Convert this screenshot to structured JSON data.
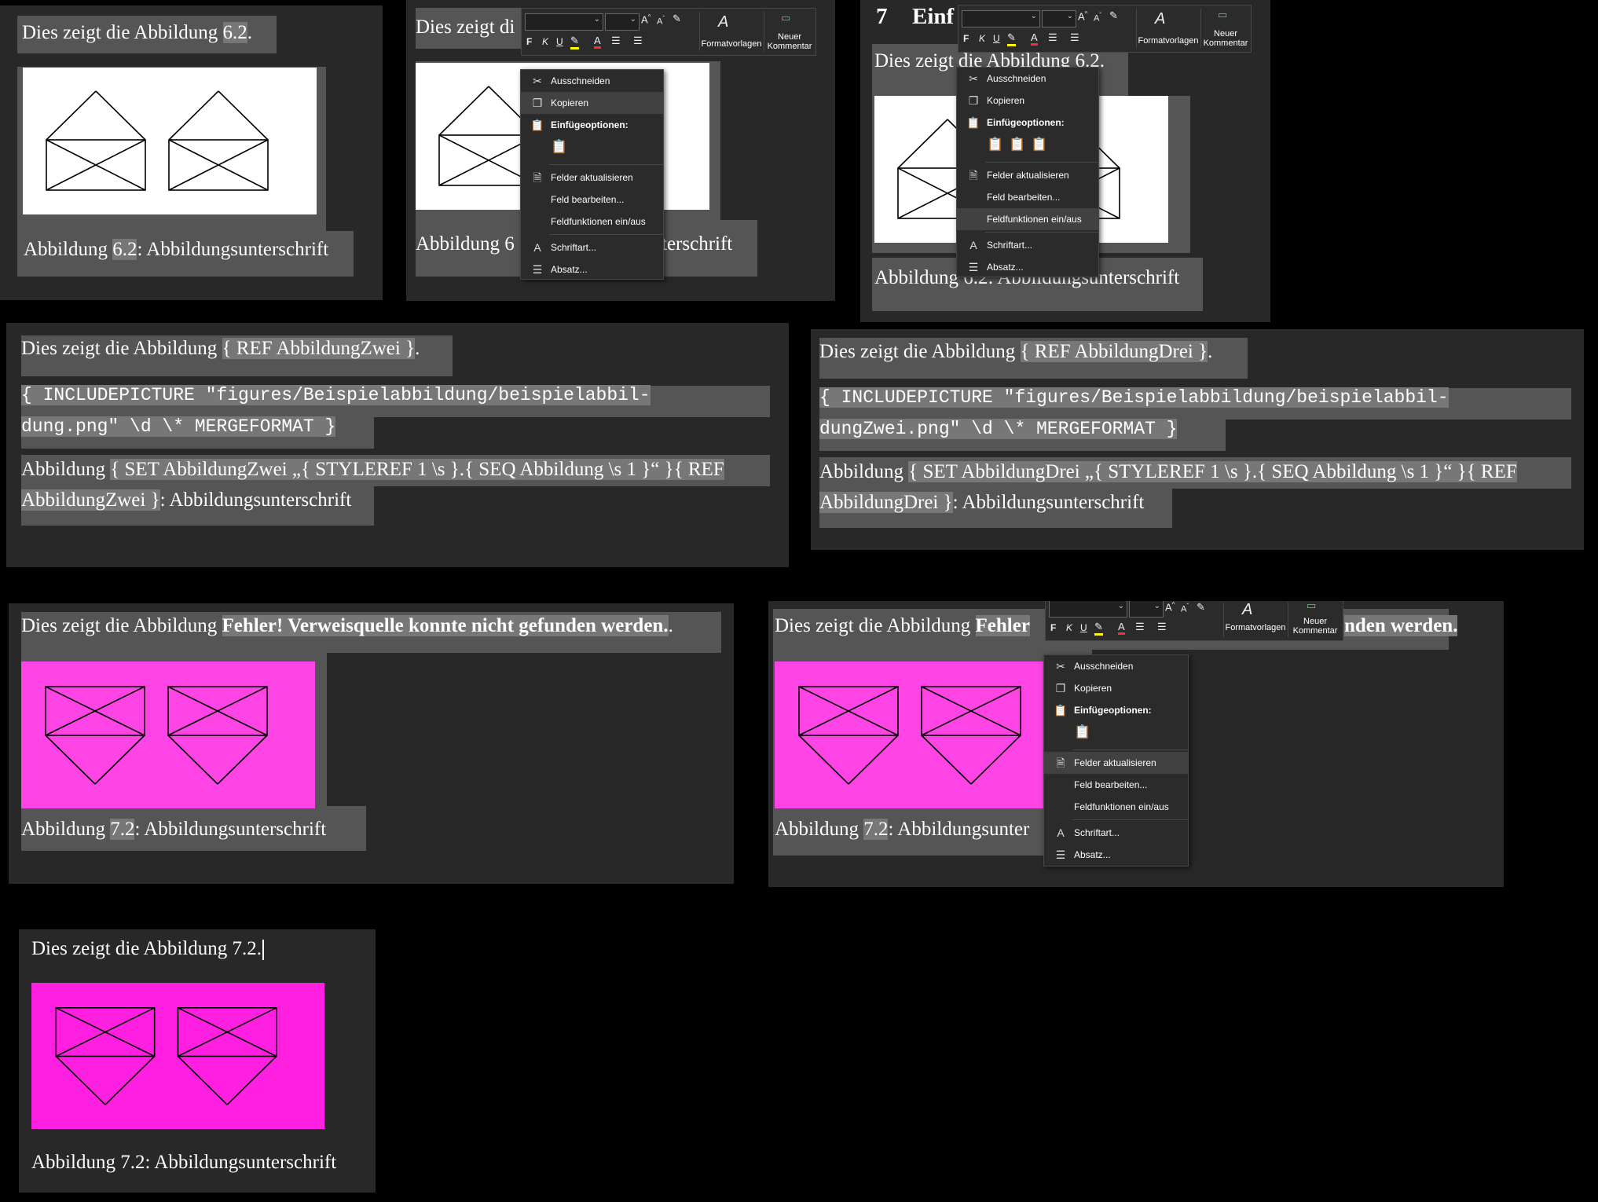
{
  "common": {
    "intro_prefix": "Dies zeigt die Abbildung ",
    "caption_word": "Abbildung",
    "caption_suffix": ": Abbildungsunterschrift",
    "period": ".",
    "caption_spaced": "Abbildung "
  },
  "panel_a": {
    "ref": "6.2"
  },
  "panel_b": {
    "intro_visible": "Dies zeigt di",
    "caption_start": "Abbildung 6",
    "caption_end": "terschrift"
  },
  "panel_c": {
    "heading_num": "7",
    "heading_text": "Einf",
    "intro_visible": "Dies zeigt die Abbildung 6.2.",
    "caption_visible": "Abbildung 6.2: Abbildungsunterschrift"
  },
  "panel_d": {
    "ref_field": "{ REF AbbildungZwei }",
    "include_line1": "{  INCLUDEPICTURE   \"figures/Beispielabbildung/beispielabbil-",
    "include_line2": "dung.png\" \\d \\* MERGEFORMAT }",
    "caption_field_line1": "{ SET AbbildungZwei „{ STYLEREF 1 \\s }.{ SEQ Abbildung \\s 1 }“ }{ REF",
    "caption_field_line2": "AbbildungZwei }"
  },
  "panel_e": {
    "ref_field": "{ REF AbbildungDrei }",
    "include_line1": "{  INCLUDEPICTURE   \"figures/Beispielabbildung/beispielabbil-",
    "include_line2": "dungZwei.png\" \\d \\* MERGEFORMAT }",
    "caption_field_line1": "{ SET AbbildungDrei „{ STYLEREF 1 \\s }.{ SEQ Abbildung \\s 1 }“ }{ REF",
    "caption_field_line2": "AbbildungDrei }"
  },
  "panel_f": {
    "error": "Fehler! Verweisquelle konnte nicht gefunden werden.",
    "ref": "7.2"
  },
  "panel_g": {
    "error_start": "Fehler",
    "error_end": "nden werden.",
    "ref": "7.2",
    "caption_end": ": Abbildungsunter"
  },
  "panel_h": {
    "intro": "Dies zeigt die Abbildung 7.2.",
    "caption_prefix": "Abbildung ",
    "caption_rest": "7.2: Abbildungsunterschrift"
  },
  "context_menu": {
    "cut": "Ausschneiden",
    "copy": "Kopieren",
    "paste_options": "Einfügeoptionen:",
    "update_fields": "Felder aktualisieren",
    "edit_field": "Feld bearbeiten...",
    "toggle_field_codes": "Feldfunktionen ein/aus",
    "font": "Schriftart...",
    "paragraph": "Absatz..."
  },
  "mini_toolbar": {
    "bold": "F",
    "italic": "K",
    "underline": "U",
    "styles": "Formatvorlagen",
    "new_comment_line1": "Neuer",
    "new_comment_line2": "Kommentar"
  },
  "icons": {
    "cut": "scissors-icon",
    "copy": "copy-icon",
    "paste": "clipboard-icon",
    "update": "document-refresh-icon",
    "font": "font-a-icon",
    "paragraph": "paragraph-icon",
    "styles": "styles-icon",
    "comment": "comment-icon"
  },
  "colors": {
    "panel_bg": "#282828",
    "highlight_box": "#555555",
    "field_shading": "#777777",
    "magenta": "#ff44e6",
    "menu_bg": "#2b2b2b"
  }
}
